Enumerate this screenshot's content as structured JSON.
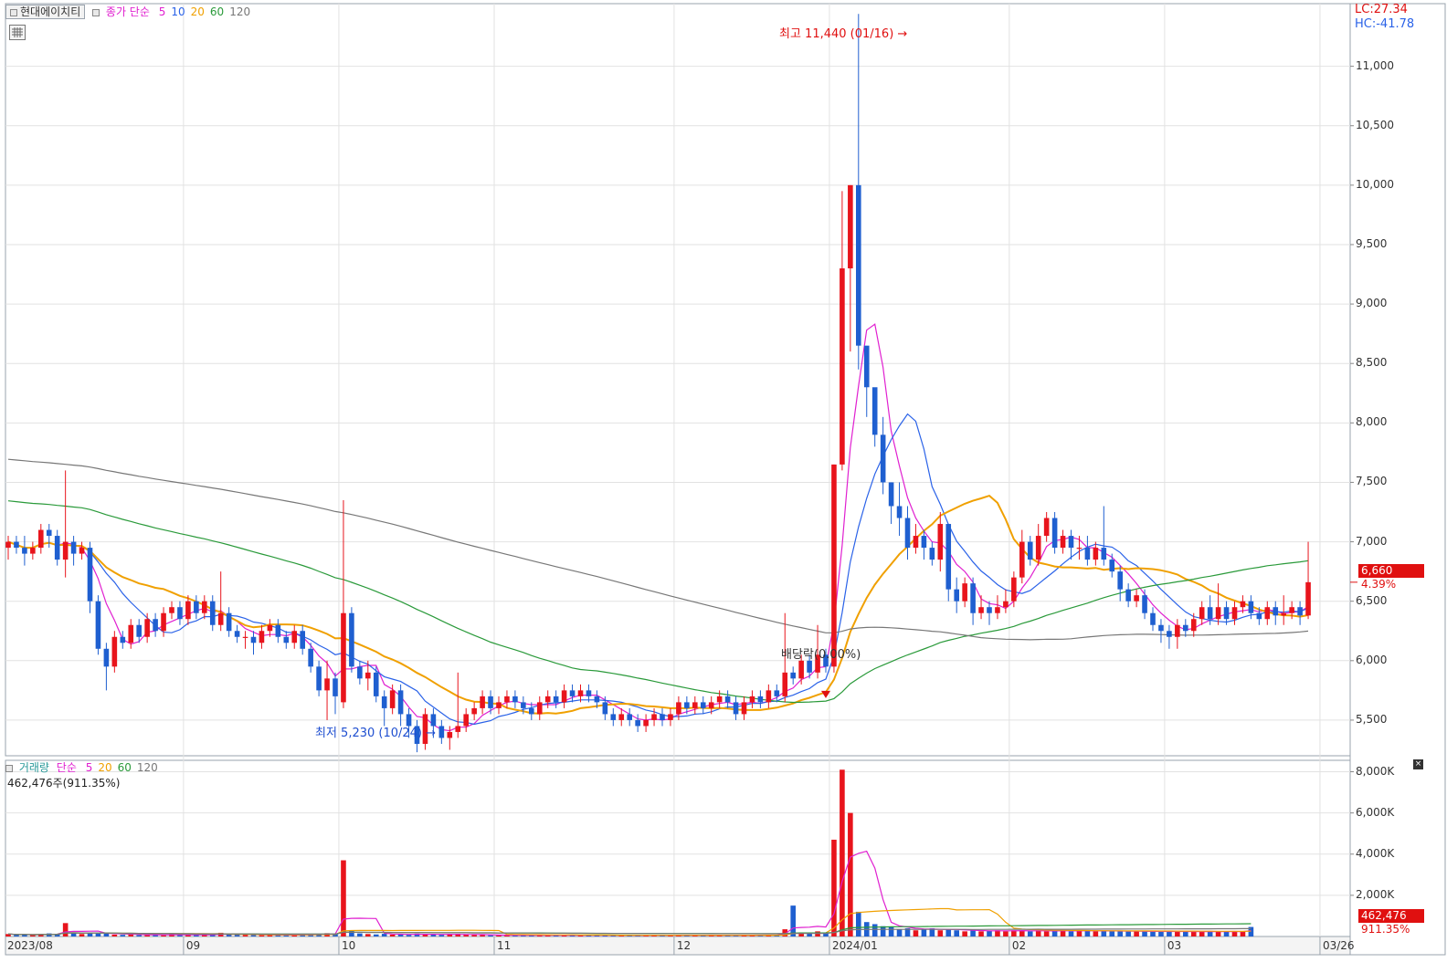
{
  "header": {
    "stock_name": "현대에이치티",
    "price_ma_label": "종가 단순",
    "ma_periods": [
      {
        "label": "5",
        "color": "#e020d0"
      },
      {
        "label": "10",
        "color": "#2a62e8"
      },
      {
        "label": "20",
        "color": "#f0a000"
      },
      {
        "label": "60",
        "color": "#2a9a3a"
      },
      {
        "label": "120",
        "color": "#777777"
      }
    ],
    "lc": "LC:27.34",
    "hc": "HC:-41.78"
  },
  "volume_header": {
    "label": "거래량",
    "ma_label": "단순",
    "ma_periods": [
      {
        "label": "5",
        "color": "#e020d0"
      },
      {
        "label": "20",
        "color": "#f0a000"
      },
      {
        "label": "60",
        "color": "#2a9a3a"
      },
      {
        "label": "120",
        "color": "#777777"
      }
    ],
    "value_text": "462,476주(911.35%)"
  },
  "price_badge": {
    "price": "6,660",
    "change": "4.39%",
    "color": "#e01010"
  },
  "volume_badge": {
    "volume": "462,476",
    "ratio": "911.35%",
    "color": "#e01010"
  },
  "annotations": {
    "high": "최고 11,440 (01/16)",
    "low": "최저 5,230 (10/24)",
    "dividend": "배당락(0.00%)"
  },
  "colors": {
    "up": "#e8141c",
    "down": "#1f5fd0"
  },
  "chart_data": {
    "type": "candlestick",
    "price_axis": {
      "ylim": [
        5200,
        11450
      ],
      "ticks": [
        5500,
        6000,
        6500,
        7000,
        7500,
        8000,
        8500,
        9000,
        9500,
        10000,
        10500,
        11000
      ],
      "tick_labels": [
        "5,500",
        "6,000",
        "6,500",
        "7,000",
        "7,500",
        "8,000",
        "8,500",
        "9,000",
        "9,500",
        "10,000",
        "10,500",
        "11,000"
      ]
    },
    "volume_axis": {
      "ylim": [
        0,
        8200
      ],
      "unit": "K",
      "ticks": [
        2000,
        4000,
        6000,
        8000
      ],
      "tick_labels": [
        "2,000K",
        "4,000K",
        "6,000K",
        "8,000K"
      ]
    },
    "x_labels": [
      {
        "label": "2023/08",
        "index": 0
      },
      {
        "label": "09",
        "index": 22
      },
      {
        "label": "10",
        "index": 41
      },
      {
        "label": "11",
        "index": 60
      },
      {
        "label": "12",
        "index": 82
      },
      {
        "label": "2024/01",
        "index": 101
      },
      {
        "label": "02",
        "index": 123
      },
      {
        "label": "03",
        "index": 142
      },
      {
        "label": "03/26",
        "index": 161
      }
    ],
    "candles": [
      [
        6950,
        7000,
        6850,
        7050
      ],
      [
        7000,
        6950,
        6900,
        7050
      ],
      [
        6950,
        6900,
        6800,
        7050
      ],
      [
        6900,
        6950,
        6850,
        7000
      ],
      [
        6950,
        7100,
        6900,
        7150
      ],
      [
        7100,
        7050,
        6950,
        7150
      ],
      [
        7050,
        6850,
        6800,
        7100
      ],
      [
        6850,
        7000,
        6700,
        7600
      ],
      [
        7000,
        6900,
        6800,
        7050
      ],
      [
        6900,
        6950,
        6850,
        7000
      ],
      [
        6950,
        6500,
        6400,
        7000
      ],
      [
        6500,
        6100,
        6050,
        6550
      ],
      [
        6100,
        5950,
        5750,
        6150
      ],
      [
        5950,
        6200,
        5900,
        6250
      ],
      [
        6200,
        6150,
        6100,
        6250
      ],
      [
        6150,
        6300,
        6100,
        6350
      ],
      [
        6300,
        6200,
        6150,
        6350
      ],
      [
        6200,
        6350,
        6150,
        6400
      ],
      [
        6350,
        6250,
        6200,
        6400
      ],
      [
        6250,
        6400,
        6200,
        6450
      ],
      [
        6400,
        6450,
        6350,
        6500
      ],
      [
        6450,
        6350,
        6300,
        6500
      ],
      [
        6350,
        6500,
        6300,
        6550
      ],
      [
        6500,
        6400,
        6350,
        6550
      ],
      [
        6400,
        6500,
        6350,
        6550
      ],
      [
        6500,
        6300,
        6250,
        6550
      ],
      [
        6300,
        6400,
        6250,
        6750
      ],
      [
        6400,
        6250,
        6200,
        6450
      ],
      [
        6250,
        6200,
        6150,
        6300
      ],
      [
        6200,
        6200,
        6100,
        6250
      ],
      [
        6200,
        6150,
        6050,
        6250
      ],
      [
        6150,
        6250,
        6100,
        6300
      ],
      [
        6250,
        6300,
        6200,
        6350
      ],
      [
        6300,
        6200,
        6150,
        6350
      ],
      [
        6200,
        6150,
        6100,
        6250
      ],
      [
        6150,
        6250,
        6100,
        6300
      ],
      [
        6250,
        6100,
        6050,
        6300
      ],
      [
        6100,
        5950,
        5900,
        6150
      ],
      [
        5950,
        5750,
        5700,
        6000
      ],
      [
        5750,
        5850,
        5500,
        6000
      ],
      [
        5850,
        5700,
        5550,
        5900
      ],
      [
        5650,
        6400,
        5600,
        7350
      ],
      [
        6400,
        5950,
        5900,
        6450
      ],
      [
        5950,
        5850,
        5800,
        6000
      ],
      [
        5850,
        5900,
        5750,
        6000
      ],
      [
        5900,
        5700,
        5650,
        5950
      ],
      [
        5700,
        5600,
        5450,
        5750
      ],
      [
        5600,
        5750,
        5550,
        5800
      ],
      [
        5750,
        5550,
        5450,
        5800
      ],
      [
        5550,
        5450,
        5350,
        5600
      ],
      [
        5450,
        5300,
        5230,
        5500
      ],
      [
        5300,
        5550,
        5250,
        5600
      ],
      [
        5550,
        5450,
        5350,
        5600
      ],
      [
        5450,
        5350,
        5300,
        5500
      ],
      [
        5350,
        5400,
        5250,
        5450
      ],
      [
        5400,
        5450,
        5350,
        5900
      ],
      [
        5450,
        5550,
        5400,
        5600
      ],
      [
        5550,
        5600,
        5500,
        5650
      ],
      [
        5600,
        5700,
        5550,
        5750
      ],
      [
        5700,
        5600,
        5550,
        5750
      ],
      [
        5600,
        5650,
        5550,
        5700
      ],
      [
        5650,
        5700,
        5600,
        5750
      ],
      [
        5700,
        5650,
        5600,
        5750
      ],
      [
        5650,
        5600,
        5550,
        5700
      ],
      [
        5600,
        5550,
        5500,
        5650
      ],
      [
        5550,
        5650,
        5500,
        5700
      ],
      [
        5650,
        5700,
        5600,
        5750
      ],
      [
        5700,
        5650,
        5600,
        5750
      ],
      [
        5650,
        5750,
        5600,
        5800
      ],
      [
        5750,
        5700,
        5650,
        5800
      ],
      [
        5700,
        5750,
        5650,
        5800
      ],
      [
        5750,
        5700,
        5650,
        5800
      ],
      [
        5700,
        5650,
        5600,
        5750
      ],
      [
        5650,
        5550,
        5500,
        5700
      ],
      [
        5550,
        5500,
        5450,
        5600
      ],
      [
        5500,
        5550,
        5450,
        5600
      ],
      [
        5550,
        5500,
        5450,
        5600
      ],
      [
        5500,
        5450,
        5400,
        5550
      ],
      [
        5450,
        5500,
        5400,
        5550
      ],
      [
        5500,
        5550,
        5450,
        5600
      ],
      [
        5550,
        5500,
        5450,
        5600
      ],
      [
        5500,
        5550,
        5450,
        5600
      ],
      [
        5550,
        5650,
        5500,
        5700
      ],
      [
        5650,
        5600,
        5550,
        5700
      ],
      [
        5600,
        5650,
        5550,
        5700
      ],
      [
        5650,
        5600,
        5550,
        5700
      ],
      [
        5600,
        5650,
        5550,
        5700
      ],
      [
        5650,
        5700,
        5600,
        5750
      ],
      [
        5700,
        5650,
        5600,
        5750
      ],
      [
        5650,
        5550,
        5500,
        5700
      ],
      [
        5550,
        5650,
        5500,
        5700
      ],
      [
        5650,
        5700,
        5600,
        5750
      ],
      [
        5700,
        5650,
        5600,
        5750
      ],
      [
        5650,
        5750,
        5600,
        5800
      ],
      [
        5750,
        5700,
        5650,
        5800
      ],
      [
        5700,
        5900,
        5650,
        6400
      ],
      [
        5900,
        5850,
        5800,
        5950
      ],
      [
        5850,
        6000,
        5800,
        6050
      ],
      [
        6000,
        5900,
        5850,
        6050
      ],
      [
        5900,
        6050,
        5850,
        6300
      ],
      [
        6050,
        5950,
        5900,
        6100
      ],
      [
        5950,
        7650,
        5900,
        7650
      ],
      [
        7650,
        9300,
        7600,
        9950
      ],
      [
        9300,
        10000,
        8600,
        10000
      ],
      [
        10000,
        8650,
        8450,
        11440
      ],
      [
        8650,
        8300,
        8050,
        8500
      ],
      [
        8300,
        7900,
        7800,
        8050
      ],
      [
        7900,
        7500,
        7400,
        8050
      ],
      [
        7500,
        7300,
        7150,
        7500
      ],
      [
        7300,
        7200,
        7050,
        7500
      ],
      [
        7200,
        6950,
        6850,
        7300
      ],
      [
        6950,
        7050,
        6900,
        7150
      ],
      [
        7050,
        6950,
        6850,
        7100
      ],
      [
        6950,
        6850,
        6800,
        7000
      ],
      [
        6850,
        7150,
        6750,
        7250
      ],
      [
        7150,
        6600,
        6500,
        7150
      ],
      [
        6600,
        6500,
        6400,
        6700
      ],
      [
        6500,
        6650,
        6450,
        6700
      ],
      [
        6650,
        6400,
        6300,
        6700
      ],
      [
        6400,
        6450,
        6350,
        6550
      ],
      [
        6450,
        6400,
        6300,
        6500
      ],
      [
        6400,
        6450,
        6350,
        6550
      ],
      [
        6450,
        6500,
        6400,
        6600
      ],
      [
        6500,
        6700,
        6450,
        6750
      ],
      [
        6700,
        7000,
        6650,
        7100
      ],
      [
        7000,
        6850,
        6800,
        7050
      ],
      [
        6850,
        7050,
        6800,
        7150
      ],
      [
        7050,
        7200,
        7000,
        7250
      ],
      [
        7200,
        6950,
        6900,
        7250
      ],
      [
        6950,
        7050,
        6900,
        7100
      ],
      [
        7050,
        6950,
        6850,
        7100
      ],
      [
        6950,
        6950,
        6850,
        7050
      ],
      [
        6950,
        6850,
        6800,
        7050
      ],
      [
        6850,
        6950,
        6800,
        7000
      ],
      [
        6950,
        6850,
        6800,
        7300
      ],
      [
        6850,
        6750,
        6700,
        6900
      ],
      [
        6750,
        6600,
        6500,
        6800
      ],
      [
        6600,
        6500,
        6450,
        6650
      ],
      [
        6500,
        6550,
        6450,
        6600
      ],
      [
        6550,
        6400,
        6350,
        6600
      ],
      [
        6400,
        6300,
        6250,
        6450
      ],
      [
        6300,
        6250,
        6150,
        6350
      ],
      [
        6250,
        6200,
        6100,
        6300
      ],
      [
        6200,
        6300,
        6100,
        6350
      ],
      [
        6300,
        6250,
        6200,
        6350
      ],
      [
        6250,
        6350,
        6200,
        6400
      ],
      [
        6350,
        6450,
        6300,
        6500
      ],
      [
        6450,
        6350,
        6300,
        6550
      ],
      [
        6350,
        6450,
        6300,
        6650
      ],
      [
        6450,
        6350,
        6300,
        6500
      ],
      [
        6350,
        6450,
        6300,
        6500
      ],
      [
        6450,
        6500,
        6400,
        6550
      ],
      [
        6500,
        6400,
        6350,
        6550
      ],
      [
        6400,
        6350,
        6300,
        6450
      ],
      [
        6350,
        6450,
        6300,
        6500
      ],
      [
        6450,
        6380,
        6300,
        6500
      ],
      [
        6380,
        6400,
        6300,
        6550
      ],
      [
        6400,
        6450,
        6350,
        6500
      ],
      [
        6450,
        6380,
        6300,
        6500
      ],
      [
        6380,
        6660,
        6350,
        7000
      ]
    ],
    "volumes": [
      120,
      80,
      90,
      70,
      110,
      150,
      130,
      650,
      200,
      120,
      180,
      150,
      140,
      90,
      80,
      100,
      70,
      90,
      80,
      60,
      110,
      90,
      70,
      90,
      80,
      100,
      180,
      110,
      90,
      80,
      70,
      60,
      90,
      70,
      80,
      60,
      90,
      110,
      130,
      160,
      120,
      3700,
      300,
      150,
      120,
      100,
      130,
      90,
      110,
      80,
      140,
      120,
      90,
      80,
      100,
      130,
      90,
      80,
      70,
      60,
      60,
      70,
      60,
      50,
      60,
      70,
      60,
      50,
      60,
      70,
      50,
      60,
      70,
      60,
      50,
      60,
      50,
      50,
      60,
      70,
      60,
      50,
      60,
      70,
      60,
      50,
      60,
      70,
      50,
      60,
      70,
      60,
      70,
      80,
      60,
      350,
      1500,
      200,
      150,
      250,
      200,
      4700,
      8100,
      6000,
      1200,
      700,
      600,
      500,
      450,
      350,
      400,
      300,
      350,
      400,
      300,
      350,
      300,
      250,
      300,
      250,
      280,
      300,
      250,
      300,
      280,
      250,
      300,
      250,
      280,
      300,
      250,
      280,
      300,
      250,
      280,
      260,
      250,
      240,
      260,
      250,
      240,
      250,
      230,
      250,
      240,
      230,
      250,
      240,
      230,
      240,
      250,
      230,
      462
    ]
  }
}
